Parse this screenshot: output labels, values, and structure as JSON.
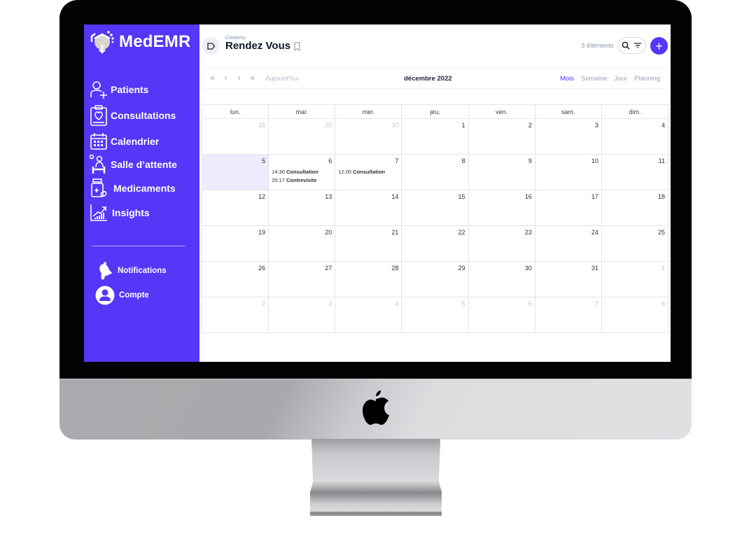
{
  "app": {
    "name": "MedEMR",
    "brand_color": "#5437f7"
  },
  "sidebar": {
    "items": [
      {
        "label": "Patients",
        "icon": "patient-add-icon"
      },
      {
        "label": "Consultations",
        "icon": "clipboard-heart-icon"
      },
      {
        "label": "Calendrier",
        "icon": "calendar-icon"
      },
      {
        "label": "Salle d’attente",
        "icon": "waiting-room-icon"
      },
      {
        "label": "Medicaments",
        "icon": "medicine-bottle-icon"
      },
      {
        "label": "Insights",
        "icon": "chart-growth-icon"
      }
    ],
    "secondary": [
      {
        "label": "Notifications",
        "icon": "bell-icon"
      },
      {
        "label": "Compte",
        "icon": "user-avatar-icon"
      }
    ]
  },
  "header": {
    "breadcrumb": "Contenu",
    "title": "Rendez Vous",
    "count": "3 éléments"
  },
  "toolbar": {
    "today": "Aujourd'hui",
    "month_title": "décembre 2022",
    "views": [
      "Mois",
      "Semaine",
      "Jour",
      "Planning"
    ],
    "active_view": "Mois"
  },
  "calendar": {
    "weekdays": [
      "lun.",
      "mar.",
      "mer.",
      "jeu.",
      "ven.",
      "sam.",
      "dim."
    ],
    "weeks": [
      [
        {
          "d": "28",
          "other": true
        },
        {
          "d": "29",
          "other": true
        },
        {
          "d": "30",
          "other": true
        },
        {
          "d": "1"
        },
        {
          "d": "2"
        },
        {
          "d": "3"
        },
        {
          "d": "4"
        }
      ],
      [
        {
          "d": "5",
          "today": true
        },
        {
          "d": "6",
          "events": [
            {
              "time": "14:30",
              "title": "Consultation"
            },
            {
              "time": "20:17",
              "title": "Contrevisite"
            }
          ]
        },
        {
          "d": "7",
          "events": [
            {
              "time": "12:00",
              "title": "Consultation"
            }
          ]
        },
        {
          "d": "8"
        },
        {
          "d": "9"
        },
        {
          "d": "10"
        },
        {
          "d": "11"
        }
      ],
      [
        {
          "d": "12"
        },
        {
          "d": "13"
        },
        {
          "d": "14"
        },
        {
          "d": "15"
        },
        {
          "d": "16"
        },
        {
          "d": "17"
        },
        {
          "d": "18"
        }
      ],
      [
        {
          "d": "19"
        },
        {
          "d": "20"
        },
        {
          "d": "21"
        },
        {
          "d": "22"
        },
        {
          "d": "23"
        },
        {
          "d": "24"
        },
        {
          "d": "25"
        }
      ],
      [
        {
          "d": "26"
        },
        {
          "d": "27"
        },
        {
          "d": "28"
        },
        {
          "d": "29"
        },
        {
          "d": "30"
        },
        {
          "d": "31"
        },
        {
          "d": "1",
          "other": true
        }
      ],
      [
        {
          "d": "2",
          "other": true
        },
        {
          "d": "3",
          "other": true
        },
        {
          "d": "4",
          "other": true
        },
        {
          "d": "5",
          "other": true
        },
        {
          "d": "6",
          "other": true
        },
        {
          "d": "7",
          "other": true
        },
        {
          "d": "8",
          "other": true
        }
      ]
    ]
  }
}
